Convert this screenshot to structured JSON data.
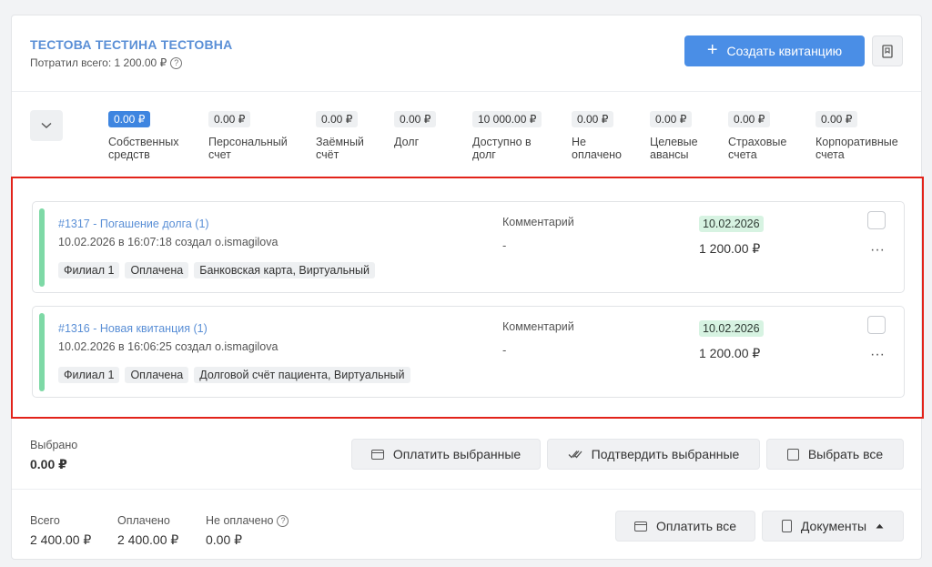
{
  "header": {
    "patient_name": "ТЕСТОВА ТЕСТИНА ТЕСТОВНА",
    "spent_text": "Потратил всего: 1 200.00 ₽",
    "create_button": "Создать квитанцию"
  },
  "balances": [
    {
      "amount": "0.00 ₽",
      "label": "Собственных средств",
      "active": true
    },
    {
      "amount": "0.00 ₽",
      "label": "Персональный счет"
    },
    {
      "amount": "0.00 ₽",
      "label": "Заёмный счёт"
    },
    {
      "amount": "0.00 ₽",
      "label": "Долг"
    },
    {
      "amount": "10 000.00 ₽",
      "label": "Доступно в долг"
    },
    {
      "amount": "0.00 ₽",
      "label": "Не оплачено"
    },
    {
      "amount": "0.00 ₽",
      "label": "Целевые авансы"
    },
    {
      "amount": "0.00 ₽",
      "label": "Страховые счета"
    },
    {
      "amount": "0.00 ₽",
      "label": "Корпоративные счета"
    }
  ],
  "receipts": [
    {
      "title": "#1317 - Погашение долга (1)",
      "meta": "10.02.2026 в 16:07:18 создал o.ismagilova",
      "tags": [
        "Филиал 1",
        "Оплачена",
        "Банковская карта, Виртуальный"
      ],
      "comment_label": "Комментарий",
      "comment": "-",
      "date": "10.02.2026",
      "sum": "1 200.00 ₽"
    },
    {
      "title": "#1316 - Новая квитанция (1)",
      "meta": "10.02.2026 в 16:06:25 создал o.ismagilova",
      "tags": [
        "Филиал 1",
        "Оплачена",
        "Долговой счёт пациента, Виртуальный"
      ],
      "comment_label": "Комментарий",
      "comment": "-",
      "date": "10.02.2026",
      "sum": "1 200.00 ₽"
    }
  ],
  "selected": {
    "label": "Выбрано",
    "value": "0.00 ₽",
    "pay_selected": "Оплатить выбранные",
    "confirm_selected": "Подтвердить выбранные",
    "select_all": "Выбрать все"
  },
  "totals": {
    "total_label": "Всего",
    "total_value": "2 400.00 ₽",
    "paid_label": "Оплачено",
    "paid_value": "2 400.00 ₽",
    "unpaid_label": "Не оплачено",
    "unpaid_value": "0.00 ₽",
    "pay_all": "Оплатить все",
    "documents": "Документы"
  },
  "icons": {
    "help": "?",
    "dots": "···"
  },
  "colors": {
    "accent": "#4a8ee6",
    "link": "#5a8fd6",
    "status_green": "#7ed9a6",
    "highlight_red": "#e2231a"
  }
}
